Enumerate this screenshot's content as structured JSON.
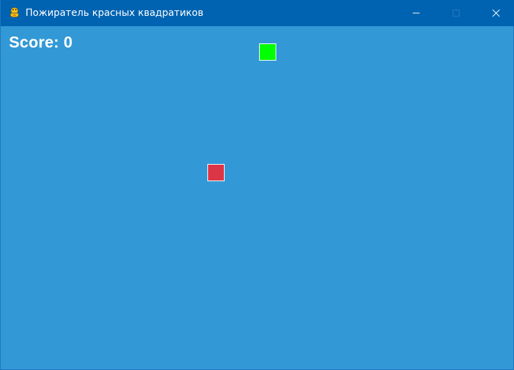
{
  "window": {
    "title": "Пожиратель красных квадратиков",
    "icon": "python-snake-icon"
  },
  "game": {
    "score_label": "Score: 0",
    "background_color": "#3399d6",
    "player_color": "#00ff00",
    "enemy_color": "#dc3545"
  },
  "colors": {
    "titlebar": "#0063b1",
    "text": "#ffffff"
  }
}
